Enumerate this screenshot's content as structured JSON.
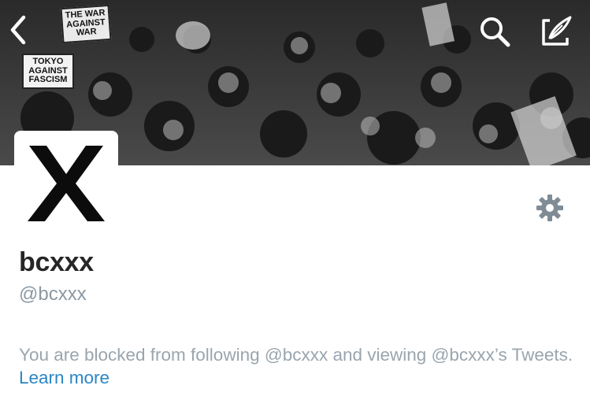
{
  "banner": {
    "description_icon": "protest-crowd-photo",
    "sign_war": "THE WAR AGAINST WAR",
    "sign_tokyo": "TOKYO AGAINST FASCISM"
  },
  "nav": {
    "back_icon": "chevron-left-icon",
    "search_icon": "search-icon",
    "compose_icon": "compose-icon"
  },
  "profile": {
    "avatar_letter": "X",
    "display_name": "bcxxx",
    "handle": "@bcxxx",
    "settings_icon": "gear-icon"
  },
  "blocked_notice": {
    "text": "You are blocked from following @bcxxx and viewing @bcxxx’s Tweets. ",
    "link_label": "Learn more"
  },
  "colors": {
    "accent": "#2a86c5",
    "muted_text": "#9aa5ae",
    "handle_text": "#8b98a3",
    "name_text": "#262626",
    "icon_gray": "#7f8c96"
  }
}
